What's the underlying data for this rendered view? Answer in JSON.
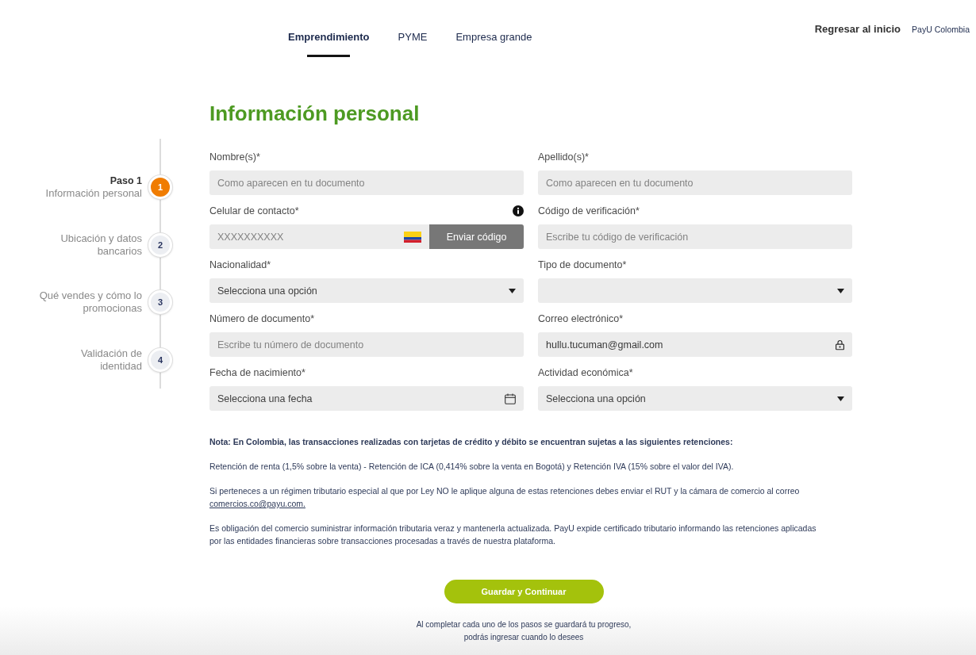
{
  "tabs": [
    {
      "label": "Emprendimiento",
      "selected": true
    },
    {
      "label": "PYME",
      "selected": false
    },
    {
      "label": "Empresa grande",
      "selected": false
    }
  ],
  "header": {
    "back_link": "Regresar al inicio",
    "country_link": "PayU Colombia"
  },
  "steps": [
    {
      "number": "1",
      "title": "Paso 1",
      "label": "Información personal",
      "selected": true
    },
    {
      "number": "2",
      "label": "Ubicación y datos bancarios",
      "selected": false
    },
    {
      "number": "3",
      "label": "Qué vendes y cómo lo promocionas",
      "selected": false
    },
    {
      "number": "4",
      "label": "Validación de identidad",
      "selected": false
    }
  ],
  "form": {
    "title": "Información personal",
    "fields": [
      {
        "kind": "text",
        "label": "Nombre(s)*",
        "placeholder": "Como aparecen en tu documento",
        "locked": false
      },
      {
        "kind": "text",
        "label": "Apellido(s)*",
        "placeholder": "Como aparecen en tu documento",
        "locked": false
      },
      {
        "kind": "phone",
        "label": "Celular de contacto*",
        "placeholder": "XXXXXXXXXX",
        "button": "Enviar código",
        "locked": false
      },
      {
        "kind": "text",
        "label": "Código de verificación*",
        "placeholder": "Escribe tu código de verificación",
        "locked": false
      },
      {
        "kind": "select",
        "label": "Nacionalidad*",
        "value": "Selecciona una opción",
        "locked": false
      },
      {
        "kind": "select",
        "label": "Tipo de documento*",
        "locked": false
      },
      {
        "kind": "text",
        "label": "Número de documento*",
        "placeholder": "Escribe tu número de documento",
        "locked": false
      },
      {
        "kind": "text",
        "label": "Correo electrónico*",
        "value": "hullu.tucuman@gmail.com",
        "locked": true
      },
      {
        "kind": "date",
        "label": "Fecha de nacimiento*",
        "value": "Selecciona una fecha",
        "locked": false
      },
      {
        "kind": "select",
        "label": "Actividad económica*",
        "value": "Selecciona una opción",
        "locked": false
      }
    ]
  },
  "note": {
    "heading": "Nota: En Colombia, las transacciones realizadas con tarjetas de crédito y débito se encuentran sujetas a las siguientes retenciones:",
    "paragraphs": [
      {
        "text": "Retención de renta (1,5% sobre la venta) - Retención de ICA (0,414% sobre la venta en Bogotá) y Retención IVA (15% sobre el valor del IVA)."
      },
      {
        "text": "Si perteneces a un régimen tributario especial al que por Ley NO le aplique alguna de estas retenciones debes enviar el RUT y la cámara de comercio al correo",
        "link": "comercios.co@payu.com."
      },
      {
        "text": "Es obligación del comercio suministrar información tributaria veraz y mantenerla actualizada. PayU expide certificado tributario informando las retenciones aplicadas por las entidades financieras sobre transacciones procesadas a través de nuestra plataforma."
      }
    ]
  },
  "submit_button": "Guardar y Continuar",
  "footer_text": "Al completar cada uno de los pasos se guardará tu progreso, podrás ingresar cuando lo desees"
}
